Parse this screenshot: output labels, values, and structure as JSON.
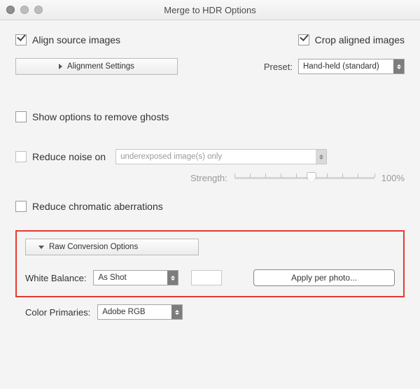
{
  "window": {
    "title": "Merge to HDR Options"
  },
  "align": {
    "label": "Align source images",
    "crop_label": "Crop aligned images",
    "settings_button": "Alignment Settings",
    "preset_label": "Preset:",
    "preset_value": "Hand-held (standard)"
  },
  "ghosts": {
    "label": "Show options to remove ghosts"
  },
  "noise": {
    "label": "Reduce noise on",
    "scope_value": "underexposed image(s) only",
    "strength_label": "Strength:",
    "strength_display": "100%"
  },
  "chromatic": {
    "label": "Reduce chromatic aberrations"
  },
  "raw": {
    "section_button": "Raw Conversion Options",
    "white_balance_label": "White Balance:",
    "white_balance_value": "As Shot",
    "apply_button": "Apply per photo...",
    "color_primaries_label": "Color Primaries:",
    "color_primaries_value": "Adobe RGB"
  }
}
